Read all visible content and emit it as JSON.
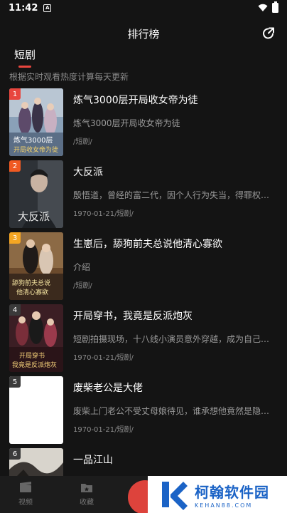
{
  "status_bar": {
    "time": "11:42",
    "notif_icon": "A"
  },
  "header": {
    "title": "排行榜"
  },
  "tabs": [
    {
      "label": "短剧"
    }
  ],
  "subtitle": "根据实时观看热度计算每天更新",
  "items": [
    {
      "rank": "1",
      "title": "炼气3000层开局收女帝为徒",
      "desc": "炼气3000层开局收女帝为徒",
      "meta": "/短剧/",
      "rank_color": "#e8463e"
    },
    {
      "rank": "2",
      "title": "大反派",
      "desc": "殷悟道，曾经的富二代，因个人行为失当，得罪权贵…",
      "meta": "1970-01-21/短剧/",
      "rank_color": "#f05a22"
    },
    {
      "rank": "3",
      "title": "生崽后，舔狗前夫总说他清心寡欲",
      "desc": "介绍",
      "meta": "/短剧/",
      "rank_color": "#f5a623"
    },
    {
      "rank": "4",
      "title": "开局穿书，我竟是反派炮灰",
      "desc": "短剧拍摄现场，十八线小演员意外穿越，成为自己饰…",
      "meta": "1970-01-21/短剧/",
      "rank_color": "#3a3a3a"
    },
    {
      "rank": "5",
      "title": "废柴老公是大佬",
      "desc": "废柴上门老公不受丈母娘待见，谁承想他竟然是隐…",
      "meta": "1970-01-21/短剧/",
      "rank_color": "#3a3a3a"
    },
    {
      "rank": "6",
      "title": "一品江山",
      "desc": "",
      "meta": "",
      "rank_color": "#3a3a3a"
    }
  ],
  "bottom_nav": [
    {
      "label": "视频",
      "icon": "clapperboard-icon"
    },
    {
      "label": "收藏",
      "icon": "folder-star-icon"
    }
  ],
  "watermark": {
    "name": "柯翰软件园",
    "domain": "KEHAN88.COM"
  }
}
